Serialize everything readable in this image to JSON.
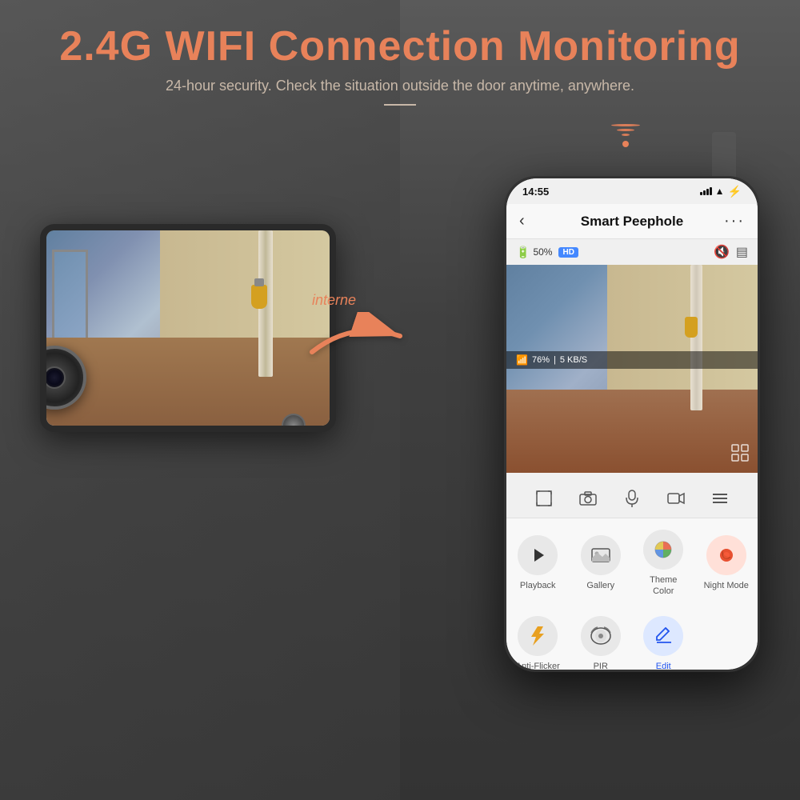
{
  "header": {
    "title": "2.4G WIFI Connection Monitoring",
    "subtitle": "24-hour security. Check the situation outside the door anytime, anywhere.",
    "divider": "—"
  },
  "arrow": {
    "label": "interne"
  },
  "phone": {
    "status_bar": {
      "time": "14:55",
      "signal": "●●●",
      "wifi": "WiFi",
      "battery": "⚡"
    },
    "app_header": {
      "title": "Smart Peephole",
      "back": "‹",
      "more": "···"
    },
    "cam_info": {
      "battery_pct": "50%",
      "quality": "HD",
      "wifi_pct": "76%",
      "speed": "5 KB/S"
    },
    "controls": {
      "fullscreen": "⛶",
      "camera": "📷",
      "mic": "🎤",
      "video": "▶",
      "menu": "≡"
    },
    "features": [
      {
        "id": "playback",
        "icon": "▶",
        "bg": "#e8e8e8",
        "icon_color": "#333",
        "label": "Playback"
      },
      {
        "id": "gallery",
        "icon": "🖼",
        "bg": "#e8e8e8",
        "icon_color": "#333",
        "label": "Gallery"
      },
      {
        "id": "theme-color",
        "icon": "🎨",
        "bg": "#e8e8e8",
        "icon_color": "#333",
        "label": "Theme\nColor"
      },
      {
        "id": "night-mode",
        "icon": "🌙",
        "bg": "#ffe8e0",
        "icon_color": "#e85030",
        "label": "Night\nMode"
      }
    ],
    "features2": [
      {
        "id": "anti-flicker",
        "icon": "⚡",
        "bg": "#e8e8e8",
        "icon_color": "#e8a020",
        "label": "Anti-Flick\ner"
      },
      {
        "id": "pir",
        "icon": "👁",
        "bg": "#e8e8e8",
        "icon_color": "#333",
        "label": "PIR"
      },
      {
        "id": "edit",
        "icon": "✎",
        "bg": "#e8f0ff",
        "icon_color": "#2255ee",
        "label": "Edit"
      },
      {
        "id": "empty",
        "icon": "",
        "bg": "transparent",
        "icon_color": "#333",
        "label": ""
      }
    ]
  }
}
